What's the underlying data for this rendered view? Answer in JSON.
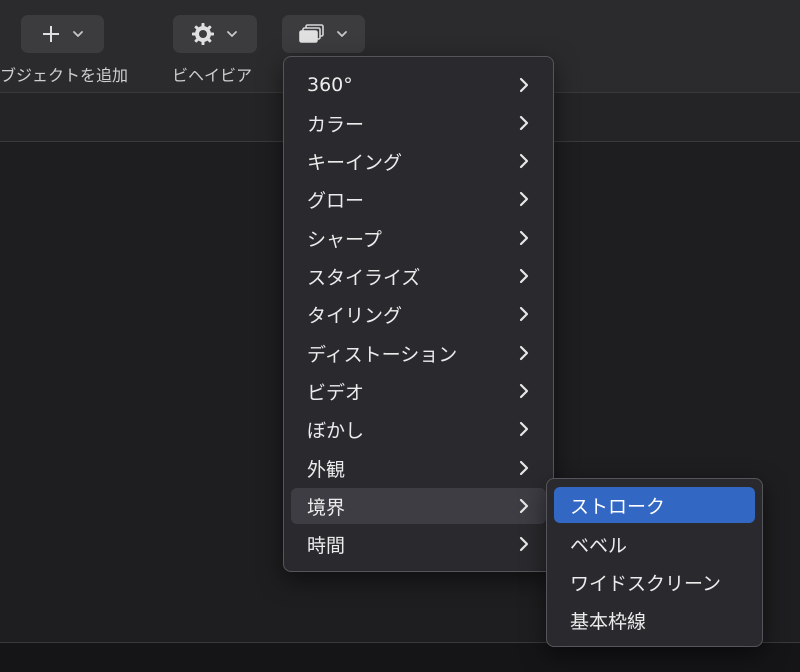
{
  "toolbar": {
    "add_object": {
      "label": "ブジェクトを追加",
      "icon": "plus-icon"
    },
    "behavior": {
      "label": "ビヘイビア",
      "icon": "gear-icon"
    },
    "filters": {
      "icon": "filters-stack-icon"
    }
  },
  "filters_menu": {
    "items": [
      {
        "label": "360°",
        "has_submenu": true
      },
      {
        "label": "カラー",
        "has_submenu": true
      },
      {
        "label": "キーイング",
        "has_submenu": true
      },
      {
        "label": "グロー",
        "has_submenu": true
      },
      {
        "label": "シャープ",
        "has_submenu": true
      },
      {
        "label": "スタイライズ",
        "has_submenu": true
      },
      {
        "label": "タイリング",
        "has_submenu": true
      },
      {
        "label": "ディストーション",
        "has_submenu": true
      },
      {
        "label": "ビデオ",
        "has_submenu": true
      },
      {
        "label": "ぼかし",
        "has_submenu": true
      },
      {
        "label": "外観",
        "has_submenu": true
      },
      {
        "label": "境界",
        "has_submenu": true,
        "state": "open"
      },
      {
        "label": "時間",
        "has_submenu": true
      }
    ]
  },
  "border_submenu": {
    "items": [
      {
        "label": "ストローク",
        "state": "selected"
      },
      {
        "label": "ベベル"
      },
      {
        "label": "ワイドスクリーン"
      },
      {
        "label": "基本枠線"
      }
    ]
  },
  "colors": {
    "selection": "#3367c4",
    "menu_bg": "#2a2a2e",
    "toolbar_bg": "#2b2b2d"
  }
}
